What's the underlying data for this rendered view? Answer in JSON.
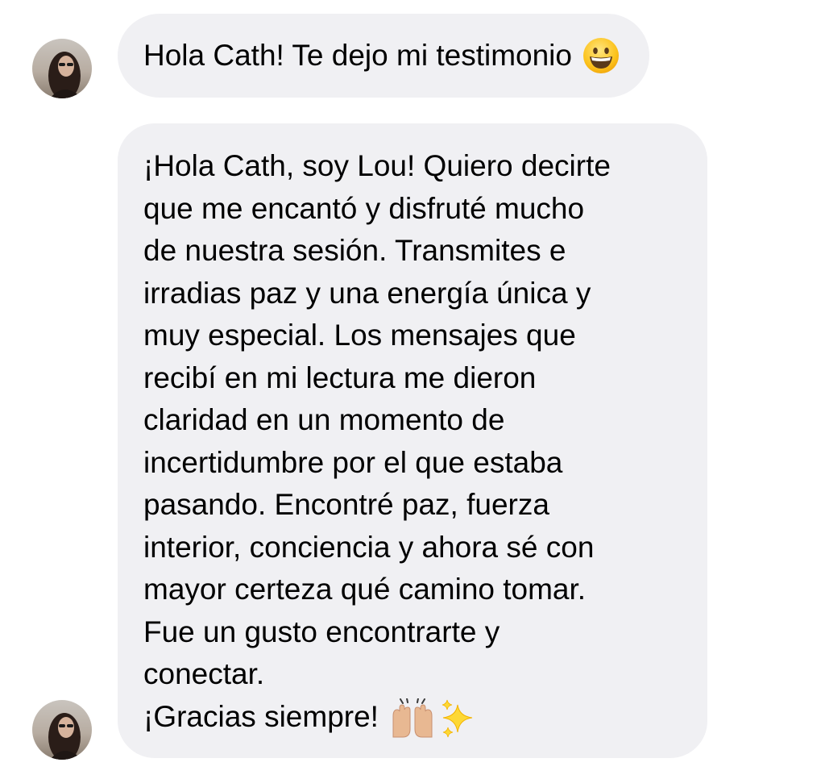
{
  "conversation": {
    "messages": [
      {
        "sender_avatar": "profile-photo",
        "text": "Hola Cath! Te dejo mi testimonio",
        "emoji": "grinning-face-emoji"
      },
      {
        "sender_avatar": "profile-photo",
        "lines": [
          "¡Hola Cath, soy Lou! Quiero decirte",
          "que me encantó y disfruté mucho",
          "de nuestra sesión. Transmites e",
          "irradias paz y una energía única y",
          "muy especial. Los mensajes que",
          "recibí en mi lectura me dieron",
          "claridad en un momento de",
          "incertidumbre por el que estaba",
          "pasando. Encontré paz, fuerza",
          "interior, conciencia y ahora sé con",
          "mayor certeza qué camino tomar.",
          "Fue un gusto encontrarte y",
          "conectar.",
          "¡Gracias siempre!"
        ],
        "trailing_emojis": [
          "raising-hands-emoji",
          "sparkles-emoji"
        ]
      }
    ]
  },
  "colors": {
    "bubble_background": "#f0f0f3",
    "text": "#000000",
    "page_background": "#ffffff"
  }
}
